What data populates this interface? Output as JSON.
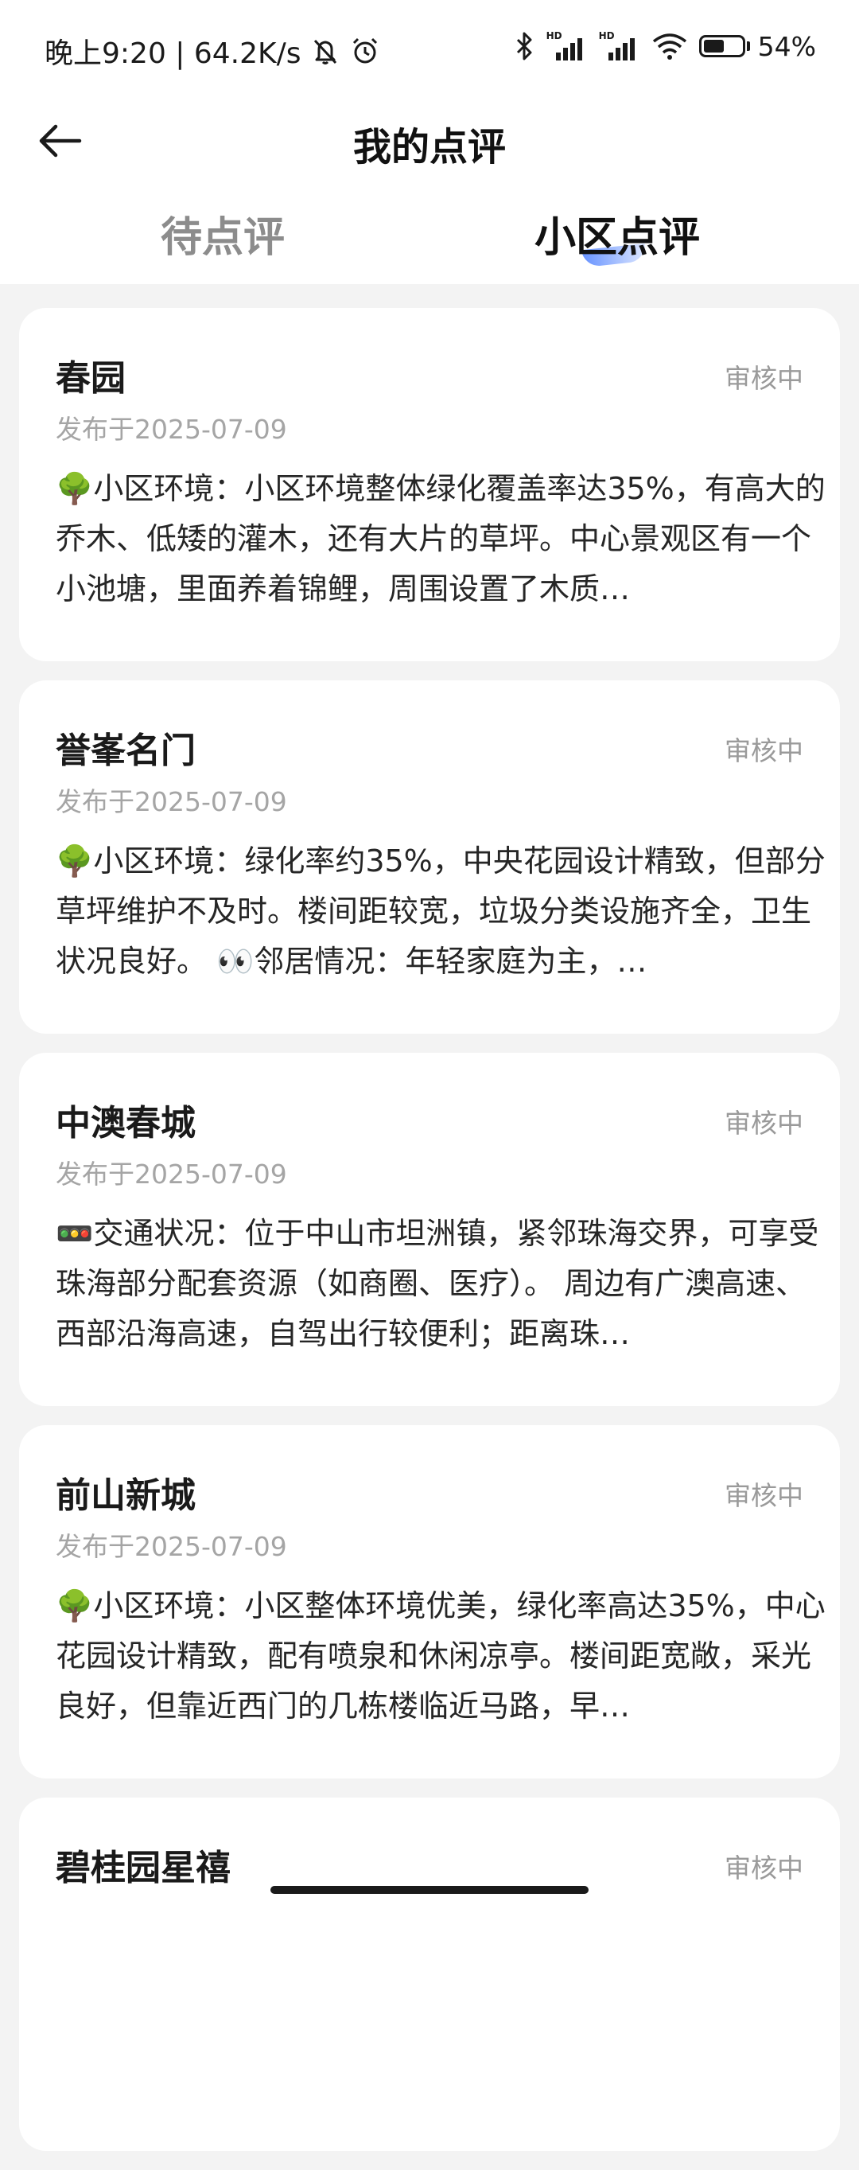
{
  "status_bar": {
    "time_speed": "晚上9:20 | 64.2K/s",
    "battery": "54%",
    "battery_level": 0.54,
    "icons": [
      "mute-icon",
      "alarm-icon",
      "bluetooth-icon",
      "hd-signal-icon",
      "hd-signal-icon",
      "wifi-icon",
      "battery-icon"
    ]
  },
  "header": {
    "title": "我的点评",
    "back_icon": "back-arrow-icon"
  },
  "tabs": [
    {
      "label": "待点评",
      "active": false
    },
    {
      "label": "小区点评",
      "active": true
    }
  ],
  "accent_color": "#4d80ff",
  "reviews": [
    {
      "name": "春园",
      "status": "审核中",
      "date": "发布于2025-07-09",
      "text": "🌳小区环境：小区环境整体绿化覆盖率达35%，有高大的乔木、低矮的灌木，还有大片的草坪。中心景观区有一个小池塘，里面养着锦鲤，周围设置了木质…"
    },
    {
      "name": "誉峯名门",
      "status": "审核中",
      "date": "发布于2025-07-09",
      "text": "🌳小区环境：绿化率约35%，中央花园设计精致，但部分草坪维护不及时。楼间距较宽，垃圾分类设施齐全，卫生状况良好。 👀邻居情况：年轻家庭为主，…"
    },
    {
      "name": "中澳春城",
      "status": "审核中",
      "date": "发布于2025-07-09",
      "text": "🚥交通状况：位于中山市坦洲镇，紧邻珠海交界，可享受珠海部分配套资源（如商圈、医疗）。 周边有广澳高速、西部沿海高速，自驾出行较便利；距离珠…"
    },
    {
      "name": "前山新城",
      "status": "审核中",
      "date": "发布于2025-07-09",
      "text": "🌳小区环境：小区整体环境优美，绿化率高达35%，中心花园设计精致，配有喷泉和休闲凉亭。楼间距宽敞，采光良好，但靠近西门的几栋楼临近马路，早…"
    },
    {
      "name": "碧桂园星禧",
      "status": "审核中",
      "date": "",
      "text": ""
    }
  ]
}
